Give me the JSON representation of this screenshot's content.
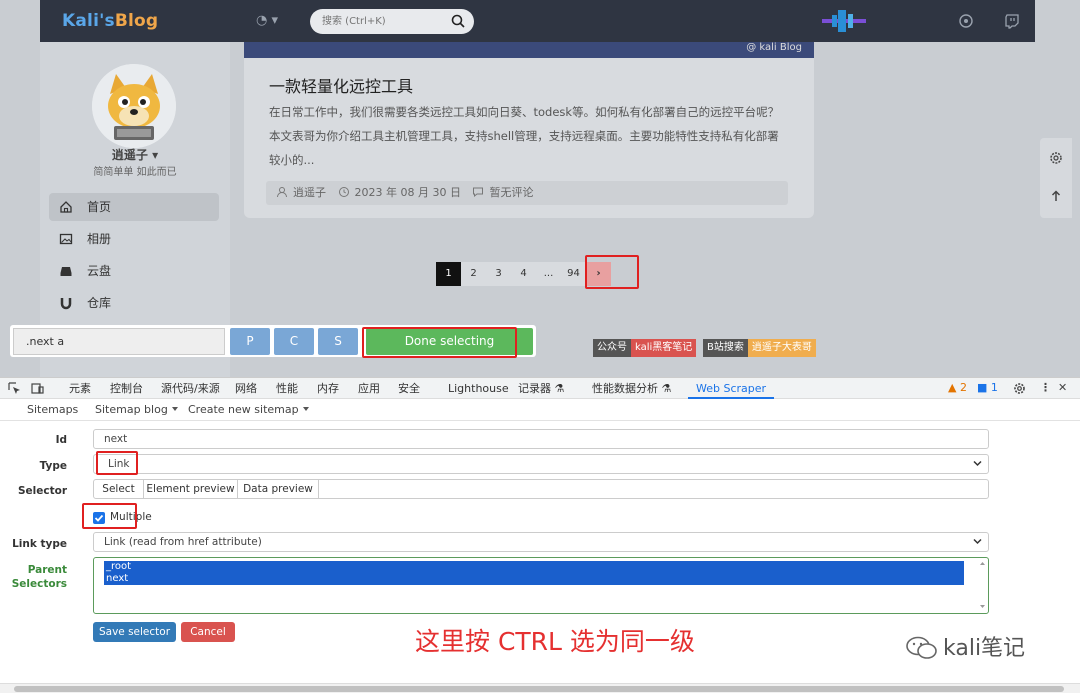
{
  "site": {
    "logo_part1": "Kali's",
    "logo_part2": "Blog",
    "search_placeholder": "搜索 (Ctrl+K)"
  },
  "sidebar": {
    "author": "逍遥子",
    "motto": "简简单单 如此而已",
    "items": [
      {
        "label": "首页",
        "icon": "home-icon"
      },
      {
        "label": "相册",
        "icon": "image-icon"
      },
      {
        "label": "云盘",
        "icon": "drive-icon"
      },
      {
        "label": "仓库",
        "icon": "magnet-icon"
      }
    ]
  },
  "article": {
    "banner_text": "@ kali Blog",
    "title": "一款轻量化远控工具",
    "description": "在日常工作中，我们很需要各类远控工具如向日葵、todesk等。如何私有化部署自己的远控平台呢？本文表哥为你介绍工具主机管理工具，支持shell管理，支持远程桌面。主要功能特性支持私有化部署较小的...",
    "author": "逍遥子",
    "date": "2023 年 08 月 30 日",
    "comments": "暂无评论"
  },
  "pagination": [
    "1",
    "2",
    "3",
    "4",
    "...",
    "94",
    "›"
  ],
  "badges": {
    "b1_left": "公众号",
    "b1_right": "kali黑客笔记",
    "b2_left": "B站搜索",
    "b2_right": "逍遥子大表哥"
  },
  "ws_toolbar": {
    "selector_value": ".next a",
    "btn_p": "P",
    "btn_c": "C",
    "btn_s": "S",
    "done": "Done selecting"
  },
  "devtools": {
    "tabs": [
      "元素",
      "控制台",
      "源代码/来源",
      "网络",
      "性能",
      "内存",
      "应用",
      "安全",
      "Lighthouse",
      "记录器 ⚗",
      "性能数据分析 ⚗",
      "Web Scraper"
    ],
    "warnings": "2",
    "messages": "1"
  },
  "ws_nav": {
    "sitemaps": "Sitemaps",
    "sitemap_blog": "Sitemap blog",
    "create_new": "Create new sitemap"
  },
  "form": {
    "id_label": "Id",
    "id_value": "next",
    "type_label": "Type",
    "type_value": "Link",
    "selector_label": "Selector",
    "seg_select": "Select",
    "seg_element_preview": "Element preview",
    "seg_data_preview": "Data preview",
    "multiple_label": "Multiple",
    "link_type_label": "Link type",
    "link_type_value": "Link (read from href attribute)",
    "parent_label_1": "Parent",
    "parent_label_2": "Selectors",
    "parent_options": [
      "_root",
      "next"
    ],
    "save": "Save selector",
    "cancel": "Cancel"
  },
  "annotation": "这里按 CTRL 选为同一级",
  "watermark": "kali笔记",
  "colors": {
    "accent": "#1a73e8",
    "highlight": "#e02020",
    "done_green": "#5cb85c",
    "save_blue": "#337ab7",
    "cancel_red": "#d9534f"
  }
}
